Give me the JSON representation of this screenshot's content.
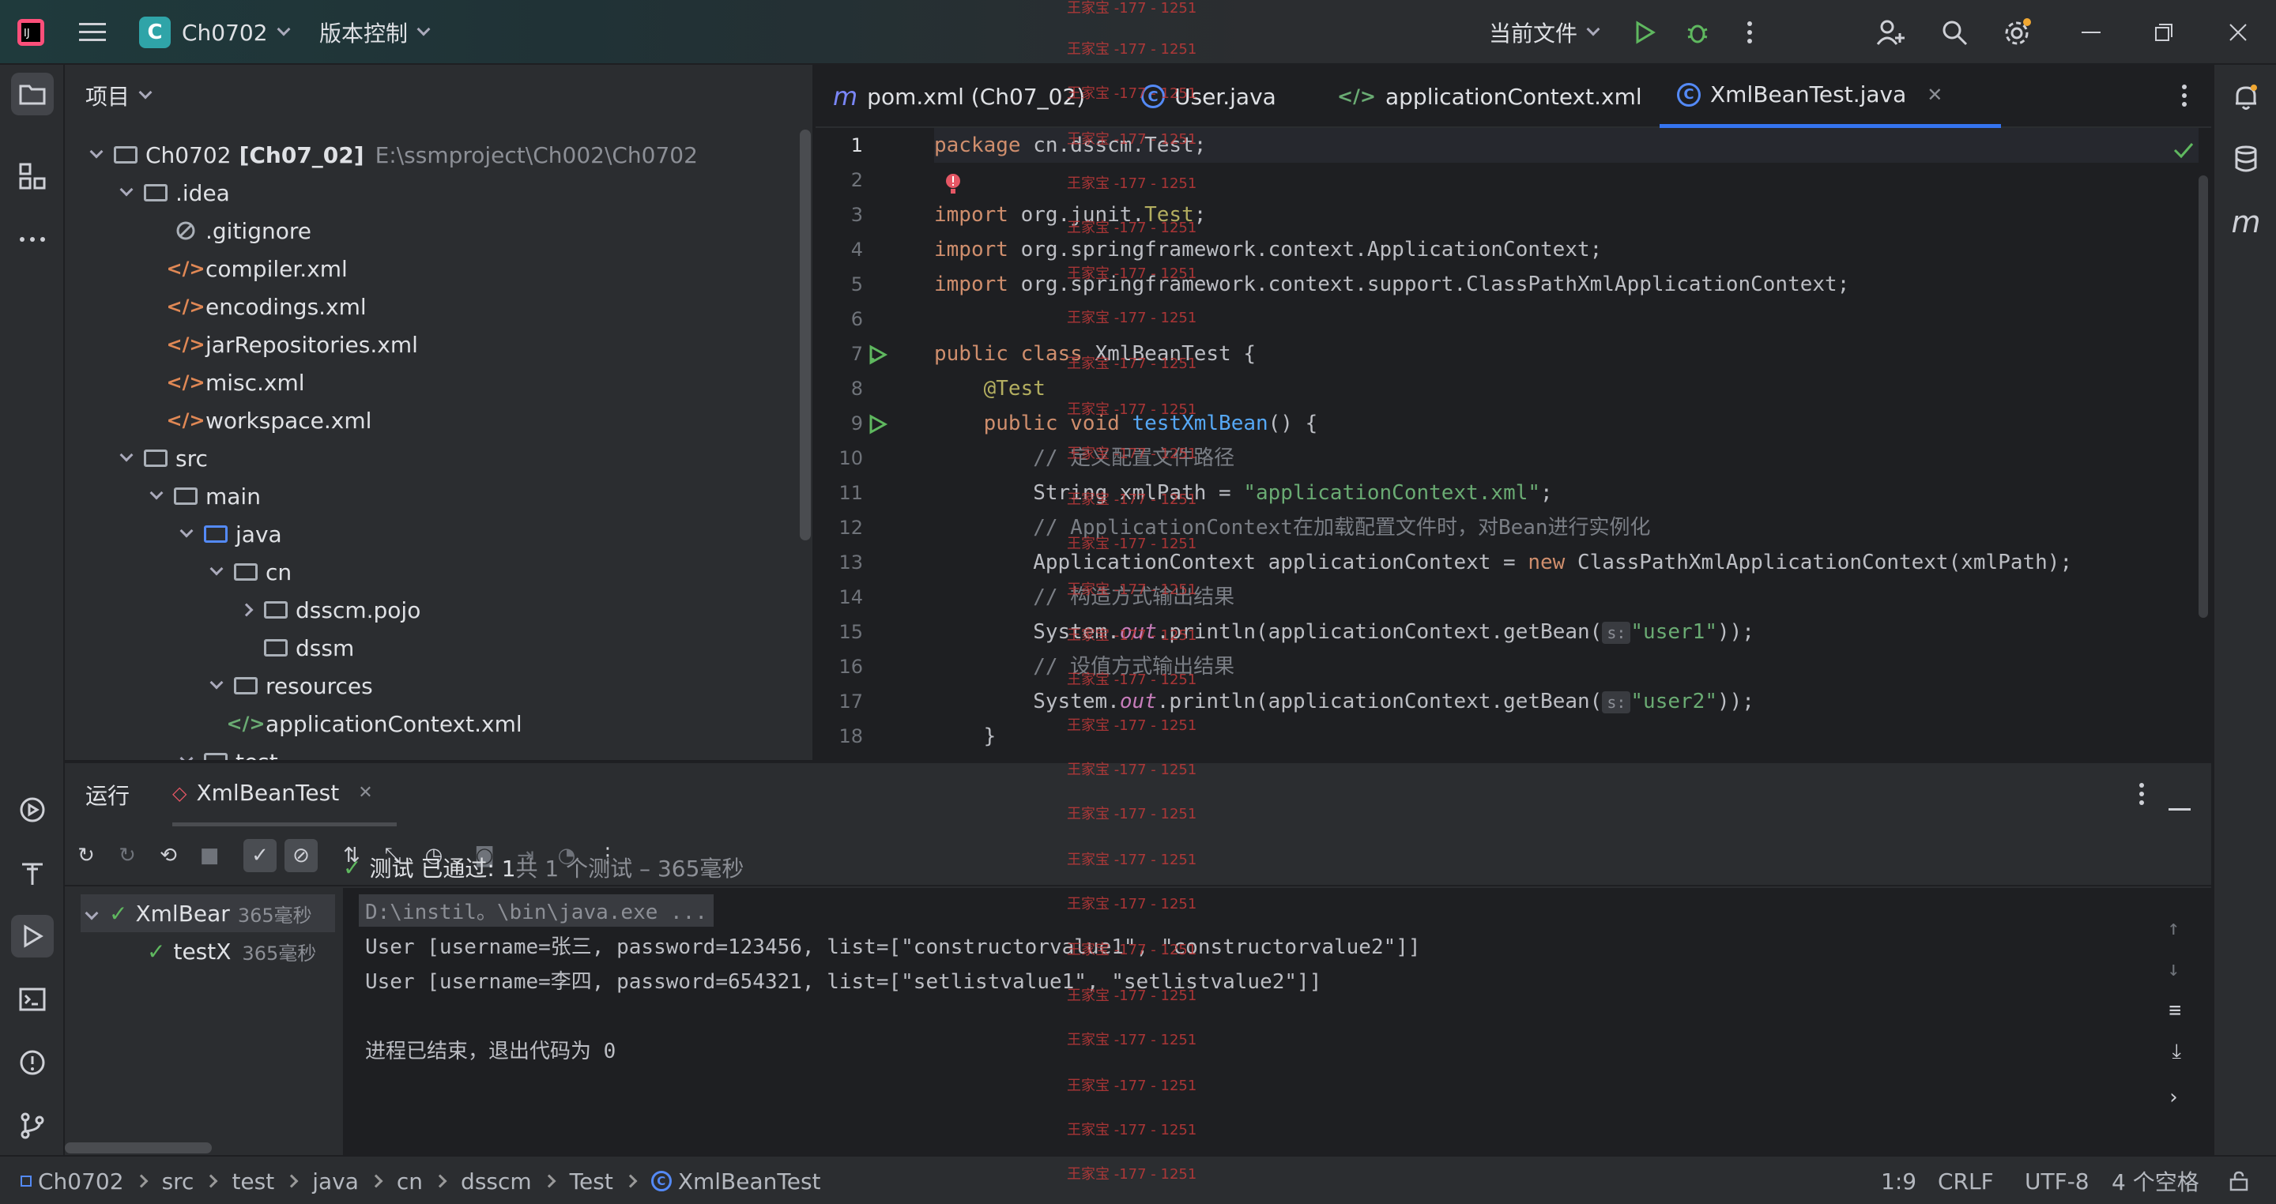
{
  "titlebar": {
    "project_badge": "C",
    "project_name": "Ch0702",
    "vcs": "版本控制",
    "run_config": "当前文件"
  },
  "project_panel": {
    "title": "项目",
    "tree": [
      {
        "label": "Ch0702",
        "extra": "[Ch07_02]",
        "path": "E:\\ssmproject\\Ch002\\Ch0702"
      },
      {
        "label": ".idea"
      },
      {
        "label": ".gitignore"
      },
      {
        "label": "compiler.xml"
      },
      {
        "label": "encodings.xml"
      },
      {
        "label": "jarRepositories.xml"
      },
      {
        "label": "misc.xml"
      },
      {
        "label": "workspace.xml"
      },
      {
        "label": "src"
      },
      {
        "label": "main"
      },
      {
        "label": "java"
      },
      {
        "label": "cn"
      },
      {
        "label": "dsscm.pojo"
      },
      {
        "label": "dssm"
      },
      {
        "label": "resources"
      },
      {
        "label": "applicationContext.xml"
      },
      {
        "label": "test"
      }
    ]
  },
  "editor": {
    "tabs": [
      {
        "label": "pom.xml (Ch07_02)"
      },
      {
        "label": "User.java"
      },
      {
        "label": "applicationContext.xml"
      },
      {
        "label": "XmlBeanTest.java",
        "active": true
      }
    ],
    "line_numbers": [
      "1",
      "2",
      "3",
      "4",
      "5",
      "6",
      "7",
      "8",
      "9",
      "10",
      "11",
      "12",
      "13",
      "14",
      "15",
      "16",
      "17",
      "18"
    ],
    "code": {
      "l1_kw": "package",
      "l1_rest": " cn.dsscm.Test;",
      "l3_kw": "import",
      "l3_rest": " org.junit.",
      "l3_ann": "Test",
      "l3_end": ";",
      "l4_kw": "import",
      "l4_rest": " org.springframework.context.ApplicationContext;",
      "l5_kw": "import",
      "l5_rest": " org.springframework.context.support.ClassPathXmlApplicationContext;",
      "l7_kw": "public class",
      "l7_rest": " XmlBeanTest {",
      "l8_ann": "    @Test",
      "l9_kw": "    public void",
      "l9_fn": " testXmlBean",
      "l9_rest": "() {",
      "l10_cmt": "        // 定义配置文件路径",
      "l11_pre": "        String xmlPath = ",
      "l11_str": "\"applicationContext.xml\"",
      "l11_end": ";",
      "l12_cmt": "        // ApplicationContext在加载配置文件时，对Bean进行实例化",
      "l13_pre": "        ApplicationContext applicationContext = ",
      "l13_kw": "new",
      "l13_rest": " ClassPathXmlApplicationContext(xmlPath);",
      "l14_cmt": "        // 构造方式输出结果",
      "l15_pre": "        System.",
      "l15_it": "out",
      "l15_mid": ".println(applicationContext.getBean(",
      "l15_hint": "s:",
      "l15_str": "\"user1\"",
      "l15_end": "));",
      "l16_cmt": "        // 设值方式输出结果",
      "l17_pre": "        System.",
      "l17_it": "out",
      "l17_mid": ".println(applicationContext.getBean(",
      "l17_hint": "s:",
      "l17_str": "\"user2\"",
      "l17_end": "));",
      "l18": "    }"
    }
  },
  "run_panel": {
    "tab_run": "运行",
    "tab_config": "XmlBeanTest",
    "tree": [
      {
        "label": "XmlBear",
        "time": "365毫秒"
      },
      {
        "label": "testX",
        "time": "365毫秒"
      }
    ],
    "summary_prefix": "测试 已通过: 1",
    "summary_suffix": "共 1 个测试 – 365毫秒",
    "console": [
      "D:\\instil。\\bin\\java.exe ...",
      "User [username=张三, password=123456, list=[\"constructorvalue1\", \"constructorvalue2\"]]",
      "User [username=李四, password=654321, list=[\"setlistvalue1\", \"setlistvalue2\"]]",
      "",
      "进程已结束，退出代码为 0"
    ]
  },
  "statusbar": {
    "breadcrumb": [
      "Ch0702",
      "src",
      "test",
      "java",
      "cn",
      "dsscm",
      "Test",
      "XmlBeanTest"
    ],
    "position": "1:9",
    "line_sep": "CRLF",
    "encoding": "UTF-8",
    "indent": "4 个空格"
  },
  "watermark": "王家宝 -177 - 1251",
  "colors": {
    "accent": "#3574f0",
    "pass": "#5fb85f",
    "keyword": "#cf8e6d",
    "string": "#6aab73"
  }
}
